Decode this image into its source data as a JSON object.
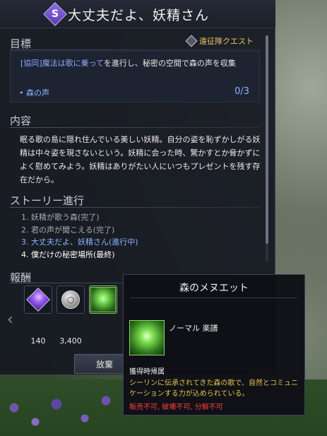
{
  "window": {
    "title": "大丈夫だよ、妖精さん",
    "emblem": "S"
  },
  "objective": {
    "header": "目標",
    "quest_type": "遠征隊クエスト",
    "text_bracket": "[協同]",
    "text_highlight": "魔法は歌に乗って",
    "text_rest": "を進行し、秘密の空間で森の声を収集",
    "item_label": "• 森の声",
    "item_progress": "0/3"
  },
  "content": {
    "header": "内容",
    "text": "眠る歌の島に隠れ住んでいる美しい妖精。自分の姿を恥ずかしがる妖精は中々姿を現さないという。妖精に会った時、驚かすとか脅かずによく慰めてみよう。妖精はありがたい人にいつもプレゼントを残す存在だから。"
  },
  "story": {
    "header": "ストーリー進行",
    "items": [
      "1. 妖精が歌う森(完了)",
      "2. 君の声が聞こえる(完了)",
      "3. 大丈夫だよ、妖精さん(進行中)",
      "4. 僕だけの秘密場所(最終)"
    ]
  },
  "rewards": {
    "header": "報酬",
    "items": [
      {
        "icon": "purple-gem-icon",
        "quantity": "140"
      },
      {
        "icon": "silver-coins-icon",
        "quantity": "3,400"
      },
      {
        "icon": "forest-minuet-score-icon",
        "quantity": ""
      }
    ]
  },
  "buttons": {
    "abandon": "放棄"
  },
  "tooltip": {
    "title": "森のメヌエット",
    "grade": "ノーマル 楽譜",
    "bind": "獲得時帰属",
    "description": "シーリンに伝承されてきた森の歌で、自然とコミュニケーションする力が込められている。",
    "restrictions": "販売不可, 破壊不可, 分解不可"
  },
  "colors": {
    "accent_blue": "#8ab4ff",
    "quest_type_gold": "#e9c46a",
    "description_gold": "#e9c44a",
    "restriction_red": "#ff3b3b",
    "panel_bg": "#161a22"
  }
}
